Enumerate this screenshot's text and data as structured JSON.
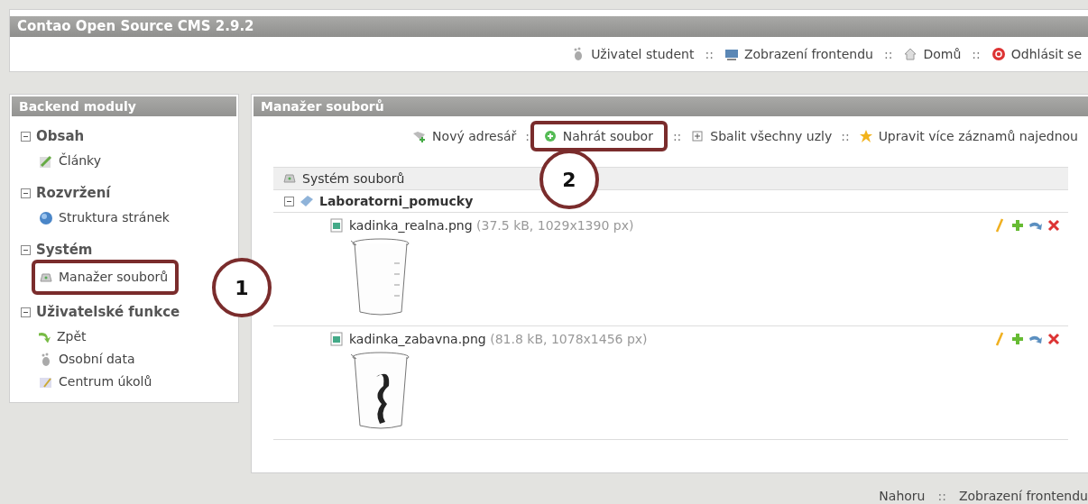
{
  "header": {
    "title": "Contao Open Source CMS 2.9.2",
    "links": [
      {
        "label": "Uživatel student"
      },
      {
        "label": "Zobrazení frontendu"
      },
      {
        "label": "Domů"
      },
      {
        "label": "Odhlásit se"
      }
    ],
    "separator": "::"
  },
  "sidebar": {
    "title": "Backend moduly",
    "groups": [
      {
        "label": "Obsah",
        "expanded": true,
        "items": [
          {
            "label": "Články"
          }
        ]
      },
      {
        "label": "Rozvržení",
        "expanded": true,
        "items": [
          {
            "label": "Struktura stránek"
          }
        ]
      },
      {
        "label": "Systém",
        "expanded": true,
        "items": [
          {
            "label": "Manažer souborů",
            "highlighted": true
          }
        ]
      },
      {
        "label": "Uživatelské funkce",
        "expanded": true,
        "items": [
          {
            "label": "Zpět"
          },
          {
            "label": "Osobní data"
          },
          {
            "label": "Centrum úkolů"
          }
        ]
      }
    ]
  },
  "main": {
    "title": "Manažer souborů",
    "toolbar": [
      {
        "label": "Nový adresář"
      },
      {
        "label": "Nahrát soubor",
        "highlighted": true
      },
      {
        "label": "Sbalit všechny uzly"
      },
      {
        "label": "Upravit více záznamů najednou"
      }
    ],
    "tree": {
      "root": "Systém souborů",
      "folder": {
        "name": "Laboratorni_pomucky",
        "expanded": true
      },
      "files": [
        {
          "name": "kadinka_realna.png",
          "meta": "(37.5 kB, 1029x1390 px)"
        },
        {
          "name": "kadinka_zabavna.png",
          "meta": "(81.8 kB, 1078x1456 px)"
        }
      ]
    }
  },
  "footer": [
    {
      "label": "Nahoru"
    },
    {
      "label": "Zobrazení frontendu"
    }
  ],
  "annotations": [
    {
      "number": "1"
    },
    {
      "number": "2"
    }
  ]
}
